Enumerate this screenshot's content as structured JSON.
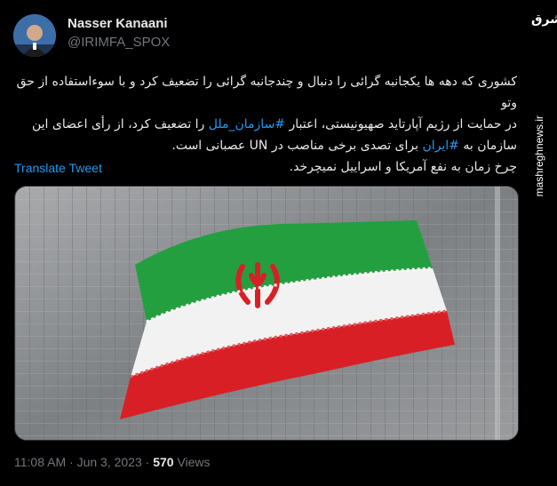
{
  "author": {
    "name": "Nasser Kanaani",
    "handle": "@IRIMFA_SPOX"
  },
  "tweet": {
    "line1": "کشوری که دهه ها یکجانبه گرائی را دنبال و چندجانبه گرائی را تضعیف کرد و با سوءاستفاده از حق وتو",
    "line2_pre": "در حمایت از رژیم آپارتاید صهیونیستی، اعتبار ",
    "line2_hashtag": "#سازمان_ملل",
    "line2_post": " را تضعیف کرد، از رأی اعضای این",
    "line3_pre": "سازمان به ",
    "line3_hashtag": "#ایران",
    "line3_post": " برای تصدی برخی مناصب در UN عصبانی است.",
    "line4": "چرخ زمان به نفع آمریکا و اسراییل نمیچرخد."
  },
  "translate_label": "Translate Tweet",
  "meta": {
    "time": "11:08 AM",
    "separator1": " · ",
    "date": "Jun 3, 2023",
    "separator2": " · ",
    "views_count": "570",
    "views_label": " Views"
  },
  "watermark": {
    "logo": "مشرق",
    "url": "mashreghnews.ir"
  },
  "media": {
    "icon": "iran-flag-image",
    "colors": {
      "green": "#239f40",
      "white": "#f1f1f1",
      "red": "#da0000"
    }
  },
  "colors": {
    "background": "#000000",
    "text": "#e7e9ea",
    "muted": "#71767b",
    "link": "#1d9bf0"
  }
}
